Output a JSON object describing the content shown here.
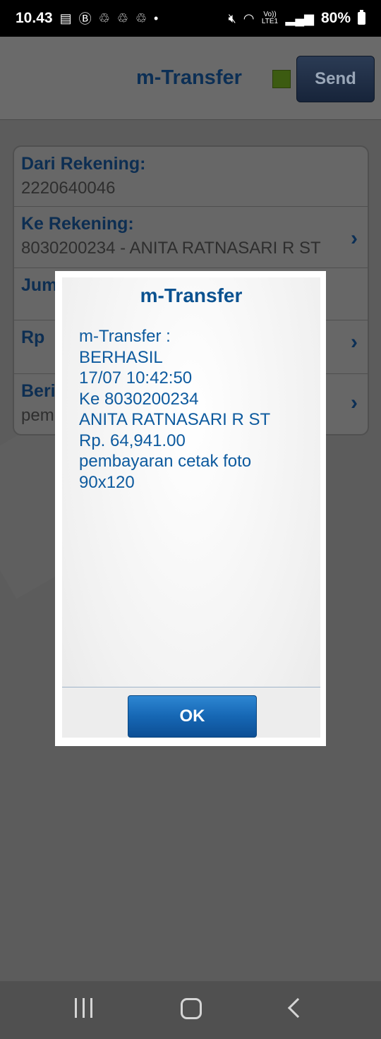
{
  "status_bar": {
    "time": "10.43",
    "left_icons": [
      "message-icon",
      "b-icon",
      "recycle-icon",
      "recycle-icon",
      "recycle-icon",
      "dot-icon"
    ],
    "right_icons": [
      "mute-icon",
      "wifi-icon",
      "volte-icon",
      "signal-icon"
    ],
    "volte_label": "Vo)) LTE1",
    "battery": "80%"
  },
  "app": {
    "header": {
      "title": "m-Transfer",
      "status_color": "#3c5b11",
      "send_label": "Send"
    },
    "form": {
      "rows": [
        {
          "label": "Dari Rekening:",
          "value": "2220640046"
        },
        {
          "label": "Ke Rekening:",
          "value": "8030200234 - ANITA RATNASARI R ST"
        },
        {
          "label": "Jum",
          "value": ""
        },
        {
          "label": "Rp",
          "value": ""
        },
        {
          "label": "Beri",
          "value": "pem"
        }
      ]
    }
  },
  "dialog": {
    "title": "m-Transfer",
    "message_lines": [
      "m-Transfer :",
      "BERHASIL",
      "17/07 10:42:50",
      "Ke 8030200234",
      "ANITA RATNASARI R ST",
      "Rp. 64,941.00",
      "pembayaran cetak foto",
      "90x120"
    ],
    "ok_label": "OK"
  },
  "nav_bar": {
    "icons": [
      "recents-icon",
      "home-icon",
      "back-icon"
    ]
  },
  "colors": {
    "accent": "#0b5290",
    "ok_button": "#1667b4"
  }
}
